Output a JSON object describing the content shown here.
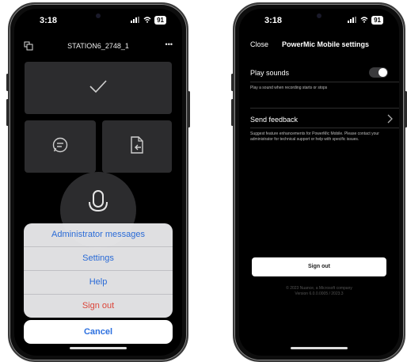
{
  "left_phone": {
    "status": {
      "time": "3:18",
      "battery": "91"
    },
    "header": {
      "title": "STATION6_2748_1",
      "more": "•••"
    },
    "action_sheet": {
      "items": [
        "Administrator messages",
        "Settings",
        "Help",
        "Sign out"
      ],
      "cancel_label": "Cancel"
    }
  },
  "right_phone": {
    "status": {
      "time": "3:18",
      "battery": "91"
    },
    "header": {
      "close_label": "Close",
      "title": "PowerMic Mobile settings"
    },
    "play_sounds": {
      "label": "Play sounds",
      "description": "Play a sound when recording starts or stops",
      "enabled": false
    },
    "send_feedback": {
      "label": "Send feedback",
      "description": "Suggest feature enhancements for PowerMic Mobile. Please contact your administrator for technical support or help with specific issues."
    },
    "sign_out_label": "Sign out",
    "footer": {
      "line1": "© 2023 Nuance, a Microsoft company",
      "line2": "Version 6.0.0.0005 / 2023.3"
    }
  }
}
